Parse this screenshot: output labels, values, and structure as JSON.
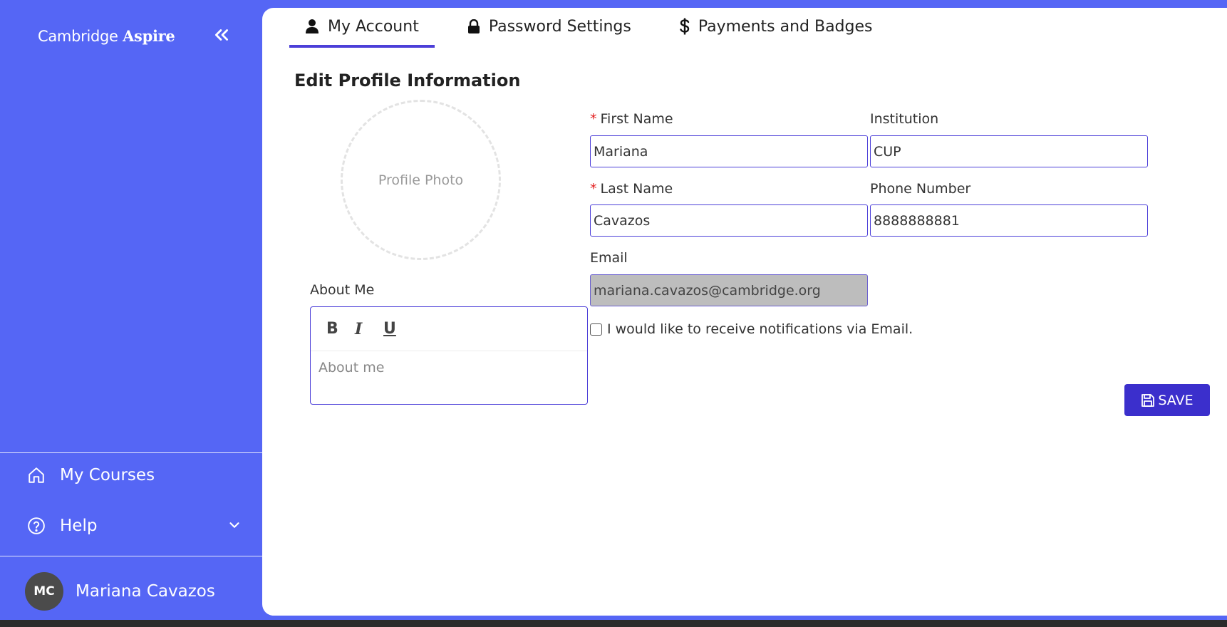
{
  "sidebar": {
    "brand_prefix": "Cambridge",
    "brand_suffix": "Aspire",
    "items": [
      {
        "label": "My Courses",
        "icon": "home-icon"
      },
      {
        "label": "Help",
        "icon": "help-circle-icon"
      }
    ],
    "user": {
      "initials": "MC",
      "name": "Mariana Cavazos"
    }
  },
  "tabs": [
    {
      "label": "My Account",
      "icon": "user-icon",
      "active": true
    },
    {
      "label": "Password Settings",
      "icon": "lock-icon",
      "active": false
    },
    {
      "label": "Payments and Badges",
      "icon": "dollar-icon",
      "active": false
    }
  ],
  "profile": {
    "section_title": "Edit Profile Information",
    "photo_placeholder": "Profile Photo",
    "about_label": "About Me",
    "about_placeholder": "About me",
    "first_name_label": "First Name",
    "first_name_value": "Mariana",
    "last_name_label": "Last Name",
    "last_name_value": "Cavazos",
    "institution_label": "Institution",
    "institution_value": "CUP",
    "phone_label": "Phone Number",
    "phone_value": "8888888881",
    "email_label": "Email",
    "email_value": "mariana.cavazos@cambridge.org",
    "required_mark": "*",
    "notify_label": "I would like to receive notifications via Email.",
    "notify_checked": false,
    "toolbar": {
      "bold": "B",
      "italic": "I",
      "underline": "U"
    },
    "save_label": "SAVE"
  },
  "colors": {
    "sidebar_bg": "#5566f5",
    "accent": "#4c3fd8",
    "save_button": "#3b2fcc",
    "required": "#e21b1b"
  }
}
